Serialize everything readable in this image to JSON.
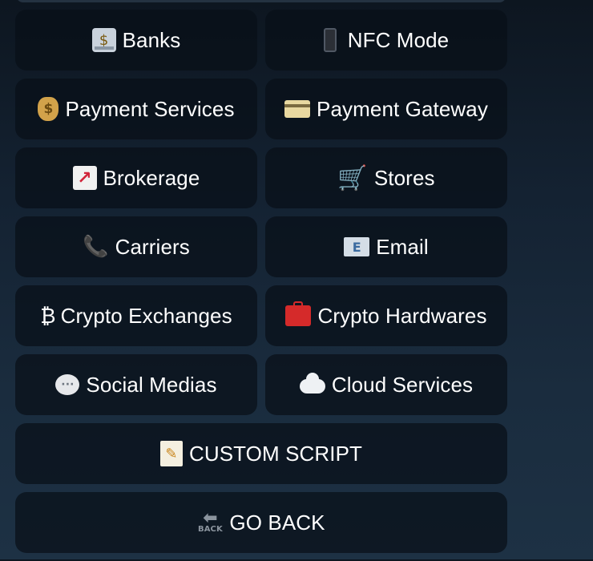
{
  "keyboard": {
    "rows": [
      [
        {
          "label": "Banks",
          "icon": "bank-icon"
        },
        {
          "label": "NFC Mode",
          "icon": "mobile-phone-icon"
        }
      ],
      [
        {
          "label": "Payment Services",
          "icon": "money-bag-icon"
        },
        {
          "label": "Payment Gateway",
          "icon": "credit-card-icon"
        }
      ],
      [
        {
          "label": "Brokerage",
          "icon": "chart-increasing-icon"
        },
        {
          "label": "Stores",
          "icon": "shopping-cart-icon"
        }
      ],
      [
        {
          "label": "Carriers",
          "icon": "telephone-receiver-icon"
        },
        {
          "label": "Email",
          "icon": "envelope-icon"
        }
      ],
      [
        {
          "label": "Crypto Exchanges",
          "icon": "bitcoin-icon"
        },
        {
          "label": "Crypto Hardwares",
          "icon": "toolbox-icon"
        }
      ],
      [
        {
          "label": "Social Medias",
          "icon": "speech-bubble-icon"
        },
        {
          "label": "Cloud Services",
          "icon": "cloud-icon"
        }
      ],
      [
        {
          "label": "CUSTOM SCRIPT",
          "icon": "memo-icon"
        }
      ],
      [
        {
          "label": "GO BACK",
          "icon": "back-arrow-icon"
        }
      ]
    ],
    "icon_glyphs": {
      "bank": "$",
      "money_bag": "$",
      "chart": "↗",
      "cart": "🛒",
      "telephone": "📞",
      "mail": "E",
      "bitcoin": "₿",
      "bubble": "···",
      "memo": "✎",
      "back_arrow": "⬅",
      "back_text": "BACK"
    }
  }
}
